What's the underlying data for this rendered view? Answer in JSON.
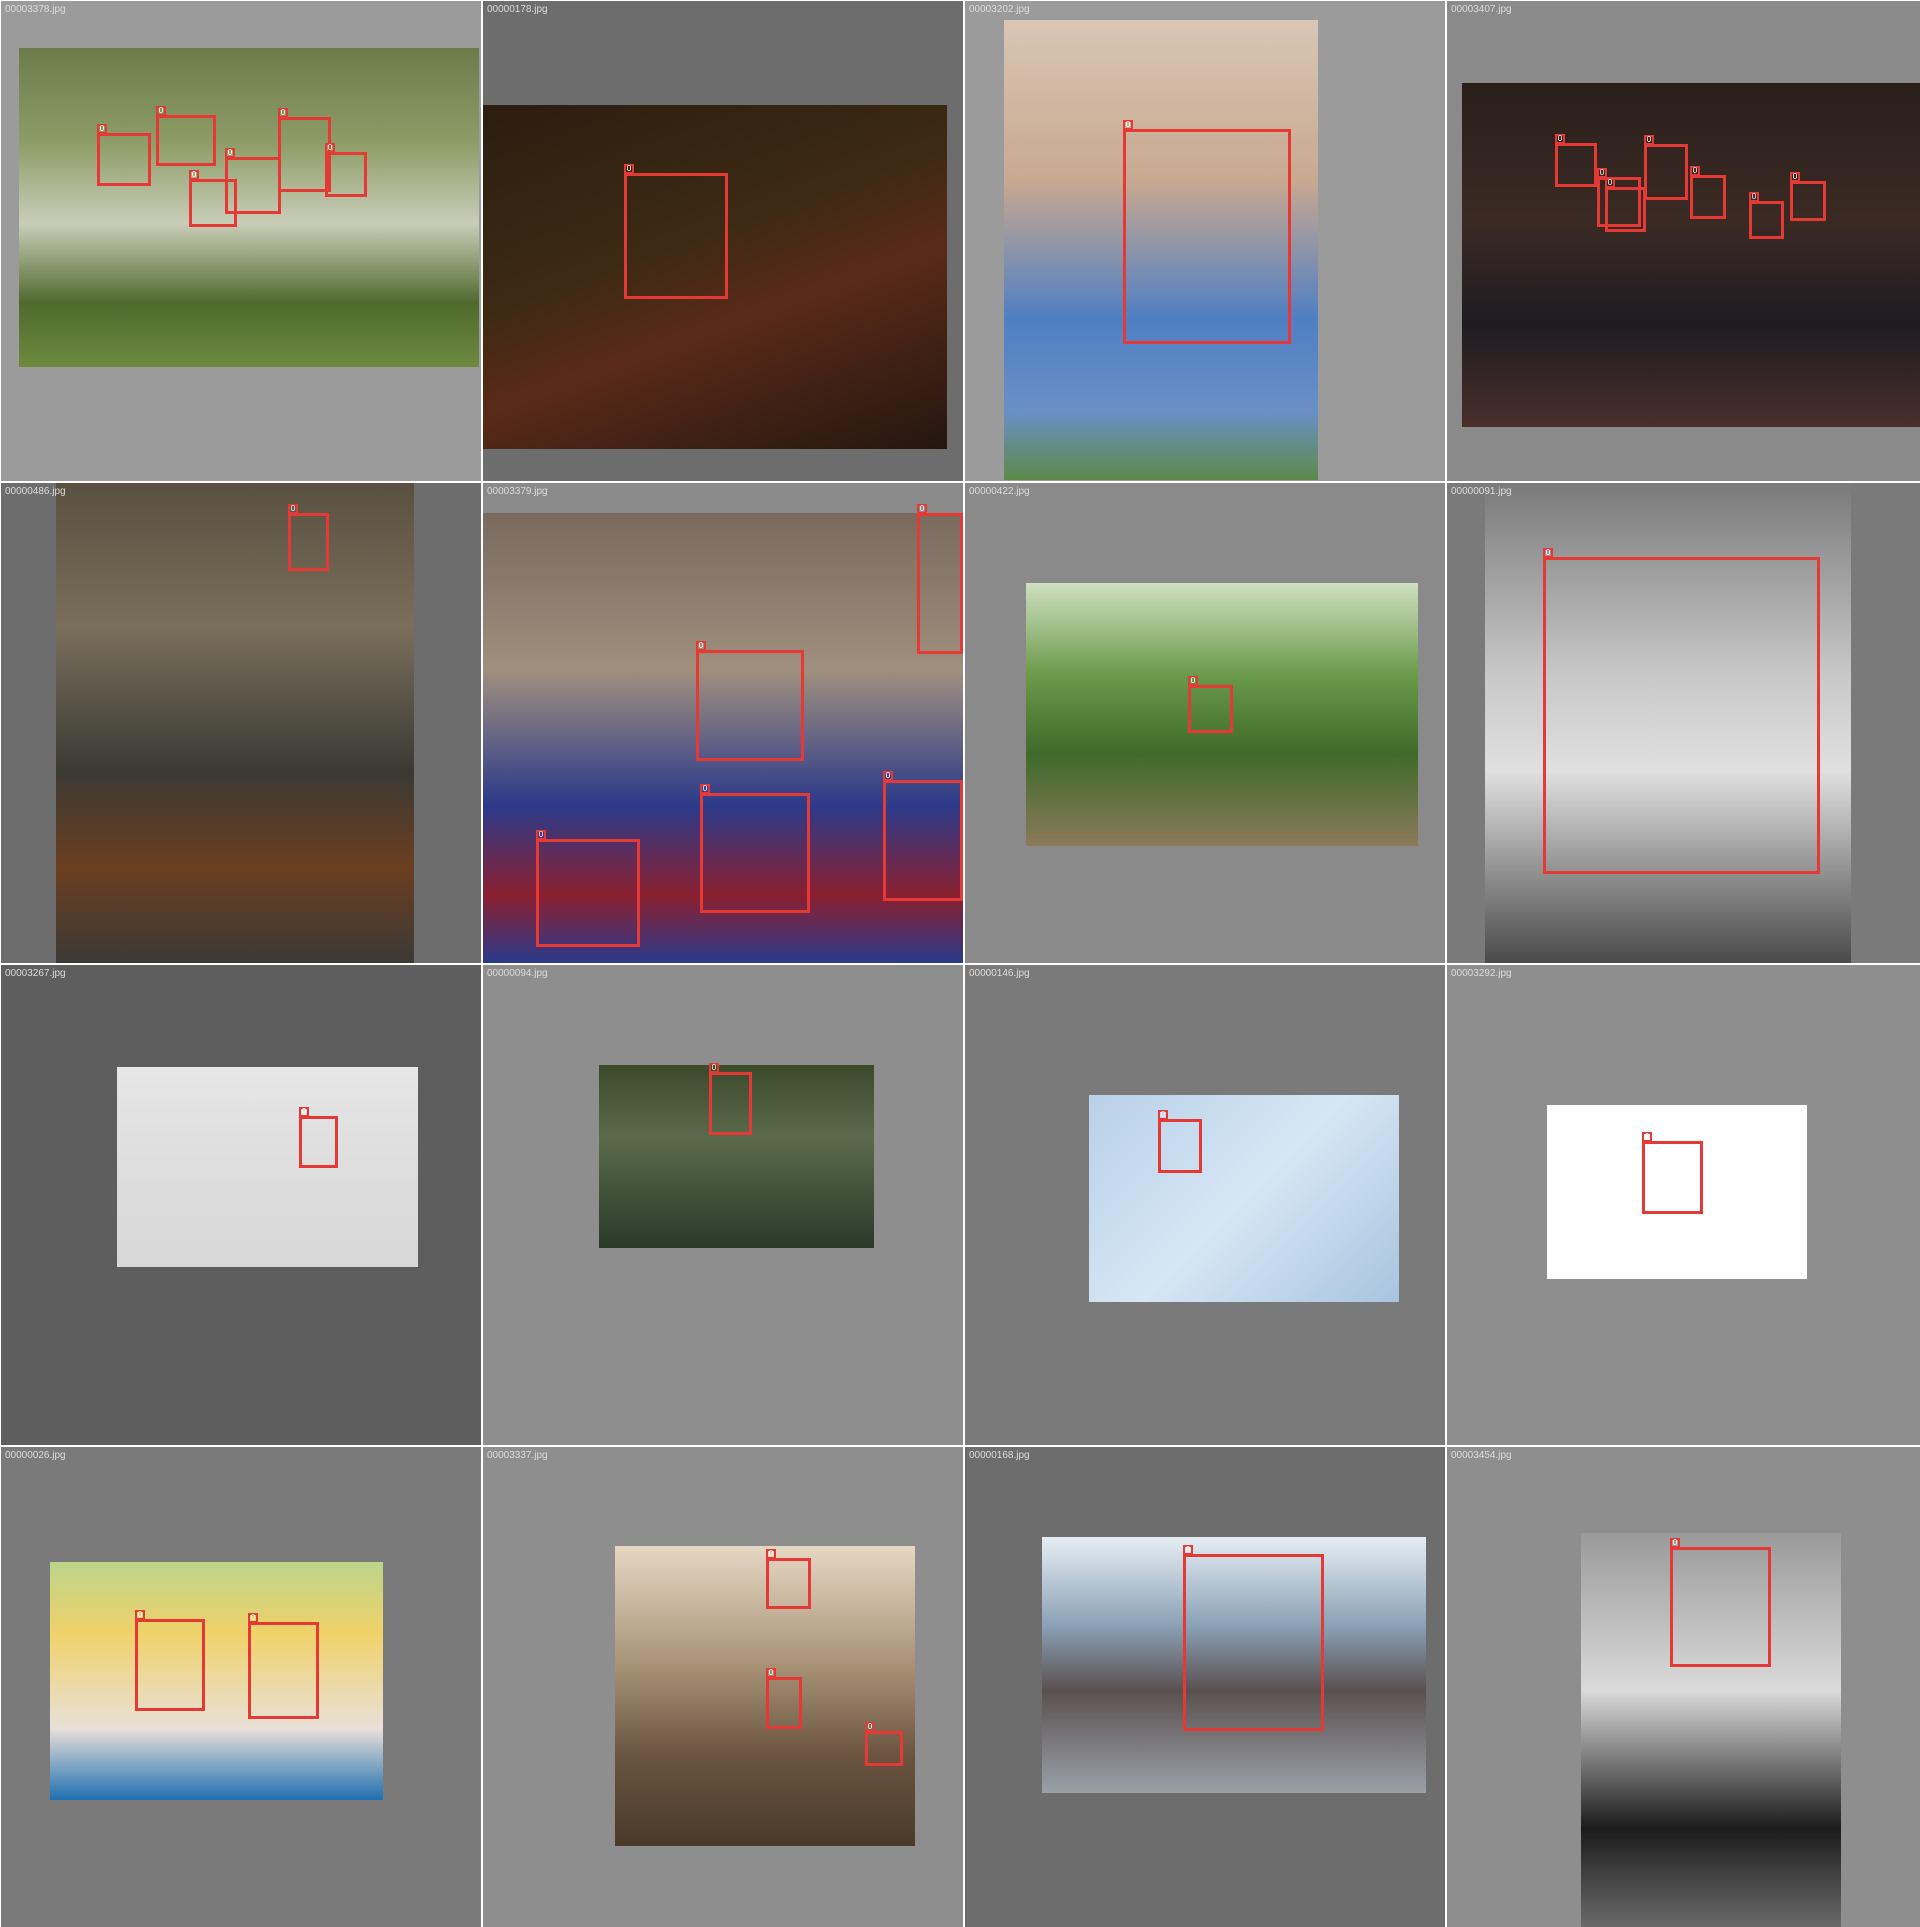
{
  "tiles": [
    {
      "file": "00003378.jpg",
      "bg": "#9b9b9b",
      "photo": "linear-gradient(180deg,#6b7b4a 0%,#8e9d68 30%,#c9cdb8 55%,#4f6a2e 80%,#6d8a3e 100%)",
      "boxes": [
        {
          "label": "0"
        },
        {
          "label": "0"
        },
        {
          "label": "0"
        },
        {
          "label": "0"
        },
        {
          "label": "0"
        },
        {
          "label": "0"
        }
      ]
    },
    {
      "file": "00000178.jpg",
      "bg": "#6d6d6d",
      "photo": "linear-gradient(160deg,#2c1d10 0%,#3c2a14 40%,#5a2a18 60%,#241710 100%)",
      "boxes": [
        {
          "label": "0"
        }
      ]
    },
    {
      "file": "00003202.jpg",
      "bg": "#9b9b9b",
      "photo": "linear-gradient(180deg,#d8c6b4 0%,#c9a890 35%,#4f7fc3 65%,#6a8fc6 85%,#5c8a4a 100%)",
      "boxes": [
        {
          "label": "0"
        }
      ]
    },
    {
      "file": "00003407.jpg",
      "bg": "#8a8a8a",
      "photo": "linear-gradient(180deg,#2a1f1a 0%,#3b2a24 40%,#1e1c22 70%,#4a2f2a 100%)",
      "boxes": [
        {
          "label": "0"
        },
        {
          "label": "0"
        },
        {
          "label": "0"
        },
        {
          "label": "0"
        },
        {
          "label": "0"
        },
        {
          "label": "0"
        },
        {
          "label": "0"
        }
      ]
    },
    {
      "file": "00000486.jpg",
      "bg": "#6d6d6d",
      "photo": "linear-gradient(180deg,#5a5040 0%,#7a6f5c 30%,#3a3a34 60%,#6b3e20 80%,#3c3a36 100%)",
      "boxes": [
        {
          "label": "0"
        }
      ]
    },
    {
      "file": "00003379.jpg",
      "bg": "#8a8a8a",
      "photo": "linear-gradient(180deg,#7a6a5e 0%,#a08f7e 35%,#2b3a8a 65%,#8a2030 85%,#2a3a8a 100%)",
      "boxes": [
        {
          "label": "0"
        },
        {
          "label": "0"
        },
        {
          "label": "0"
        },
        {
          "label": "0"
        },
        {
          "label": "0"
        }
      ]
    },
    {
      "file": "00000422.jpg",
      "bg": "#8a8a8a",
      "photo": "linear-gradient(180deg,#cfe0c0 0%,#6a9a4a 35%,#3f6a2a 65%,#8a7a5a 100%)",
      "boxes": [
        {
          "label": "0"
        }
      ]
    },
    {
      "file": "00000091.jpg",
      "bg": "#7a7a7a",
      "photo": "linear-gradient(180deg,#7a7a7a 0%,#c8c8c8 40%,#e0e0e0 60%,#4a4a4a 100%)",
      "boxes": [
        {
          "label": "0"
        }
      ]
    },
    {
      "file": "00003267.jpg",
      "bg": "#5e5e5e",
      "photo": "linear-gradient(180deg,#e6e6e6 0%,#dcdcdc 60%,#d8d8d8 100%)",
      "boxes": [
        {
          "label": "0"
        }
      ]
    },
    {
      "file": "00000094.jpg",
      "bg": "#8e8e8e",
      "photo": "linear-gradient(180deg,#3a4a2a 0%,#5a6a4a 40%,#2a3a2a 100%)",
      "boxes": [
        {
          "label": "0"
        }
      ]
    },
    {
      "file": "00000146.jpg",
      "bg": "#7a7a7a",
      "photo": "linear-gradient(135deg,#b8d0e8 0%,#d6e6f4 50%,#a8c4e0 100%)",
      "boxes": [
        {
          "label": "0"
        }
      ]
    },
    {
      "file": "00003292.jpg",
      "bg": "#8e8e8e",
      "photo": "linear-gradient(180deg,#ffffff 0%,#ffffff 100%)",
      "boxes": [
        {
          "label": "0"
        }
      ]
    },
    {
      "file": "00000026.jpg",
      "bg": "#7a7a7a",
      "photo": "linear-gradient(180deg,#bcd48a 0%,#f0d26a 30%,#e8e0d8 70%,#1f6fb0 100%)",
      "boxes": [
        {
          "label": "0"
        },
        {
          "label": "0"
        }
      ]
    },
    {
      "file": "00003337.jpg",
      "bg": "#8e8e8e",
      "photo": "linear-gradient(180deg,#e6d7c3 0%,#a89276 40%,#6a5440 70%,#4a3a2a 100%)",
      "boxes": [
        {
          "label": "0"
        },
        {
          "label": "0"
        },
        {
          "label": "0"
        }
      ]
    },
    {
      "file": "00000168.jpg",
      "bg": "#6d6d6d",
      "photo": "linear-gradient(180deg,#e6eef4 0%,#8aa0b4 35%,#5a5050 60%,#9aa0a8 100%)",
      "boxes": [
        {
          "label": "0"
        }
      ]
    },
    {
      "file": "00003454.jpg",
      "bg": "#8e8e8e",
      "photo": "linear-gradient(180deg,#9a9a9a 0%,#dadada 40%,#1c1c1c 75%,#6a6a6a 100%)",
      "boxes": [
        {
          "label": "0"
        }
      ]
    }
  ]
}
